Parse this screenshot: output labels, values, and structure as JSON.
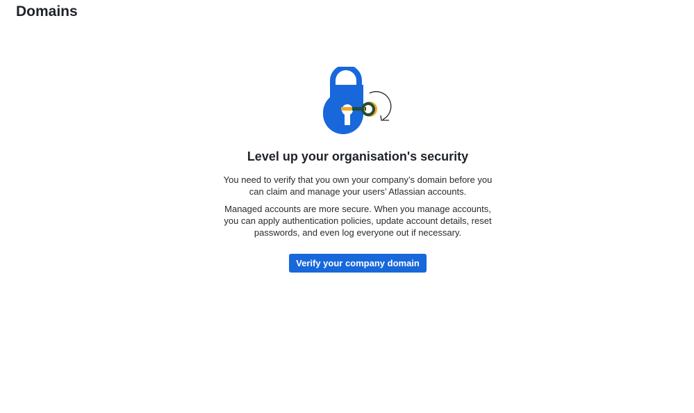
{
  "page": {
    "title": "Domains"
  },
  "empty_state": {
    "illustration_icon": "padlock-key-icon",
    "headline": "Level up your organisation's security",
    "paragraph_1": "You need to verify that you own your company’s domain before you can claim and manage your users’ Atlassian accounts.",
    "paragraph_2": "Managed accounts are more secure. When you manage accounts, you can apply authentication policies, update account details, reset passwords, and even log everyone out if necessary.",
    "cta_label": "Verify your company domain"
  },
  "colors": {
    "brand_blue": "#1868db",
    "key_orange": "#f5a623",
    "key_green": "#1f4d3a",
    "text": "#292a2e"
  }
}
